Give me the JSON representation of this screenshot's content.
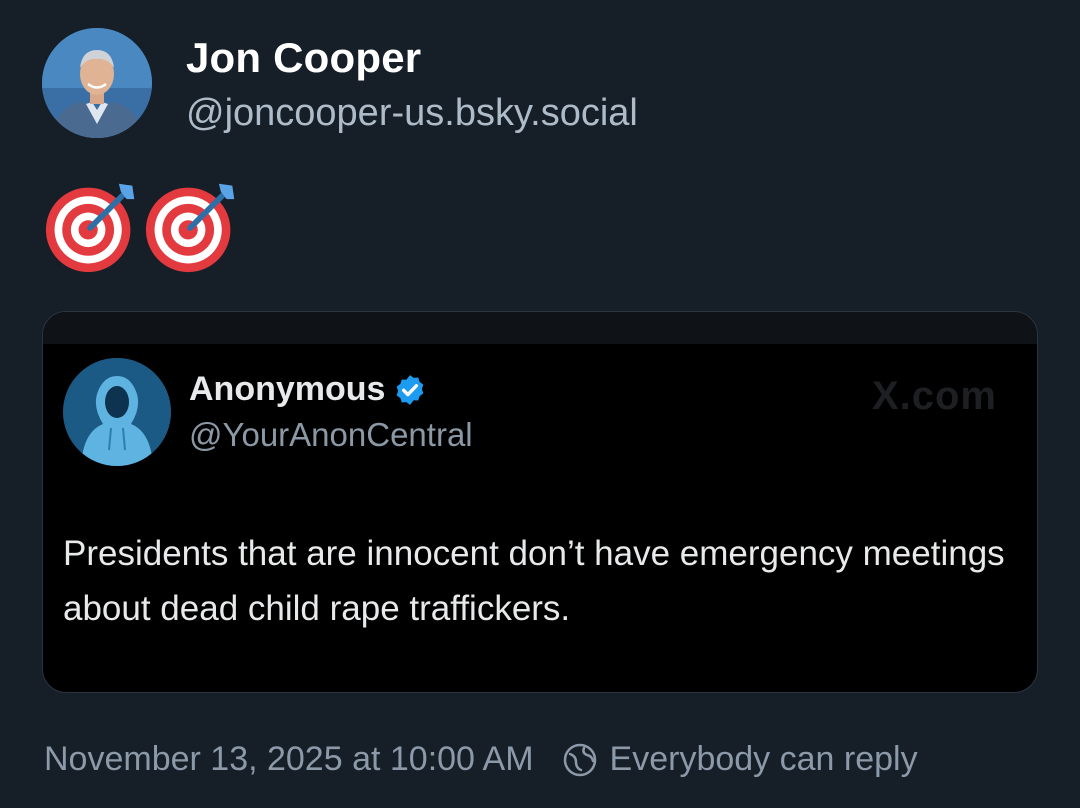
{
  "author": {
    "name": "Jon Cooper",
    "handle": "@joncooper-us.bsky.social",
    "avatar_icon": "profile-photo-man-suit"
  },
  "post": {
    "emoji_icons": [
      "direct-hit-target-icon",
      "direct-hit-target-icon"
    ]
  },
  "embed": {
    "name": "Anonymous",
    "handle": "@YourAnonCentral",
    "verified": true,
    "verified_color": "#1d9bf0",
    "watermark": "X.com",
    "text": "Presidents that are innocent don’t have emergency meetings about dead child rape traffickers.",
    "avatar_icon": "hooded-figure-avatar"
  },
  "footer": {
    "timestamp": "November 13, 2025 at 10:00 AM",
    "reply_setting": "Everybody can reply",
    "reply_icon": "globe-icon"
  },
  "colors": {
    "background": "#161e27",
    "embed_background": "#000000",
    "secondary_text": "#aebbc9"
  }
}
